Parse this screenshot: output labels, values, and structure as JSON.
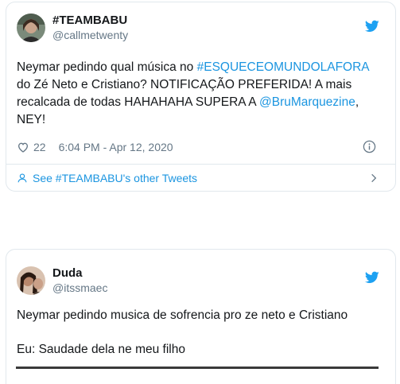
{
  "tweets": [
    {
      "display_name": "#TEAMBABU",
      "handle": "@callmetwenty",
      "body": [
        {
          "text": "Neymar pedindo qual música no ",
          "link": false
        },
        {
          "text": "#ESQUECEOMUNDOLAFORA",
          "link": true
        },
        {
          "text": " do Zé Neto e Cristiano? NOTIFICAÇÃO PREFERIDA! A mais recalcada de todas HAHAHAHA SUPERA A ",
          "link": false
        },
        {
          "text": "@BruMarquezine",
          "link": true
        },
        {
          "text": ", NEY!",
          "link": false
        }
      ],
      "likes": "22",
      "timestamp": "6:04 PM - Apr 12, 2020",
      "see_more": "See #TEAMBABU's other Tweets"
    },
    {
      "display_name": "Duda",
      "handle": "@itssmaec",
      "body_line1": "Neymar pedindo musica de sofrencia pro ze neto e Cristiano",
      "body_line2": "Eu: Saudade dela ne meu filho"
    }
  ],
  "colors": {
    "twitter_blue": "#1da1f2",
    "link": "#1b95e0",
    "muted": "#657786",
    "border": "#e1e8ed"
  },
  "icons": [
    "twitter-bird-icon",
    "heart-icon",
    "info-icon",
    "user-icon",
    "chevron-right-icon"
  ]
}
